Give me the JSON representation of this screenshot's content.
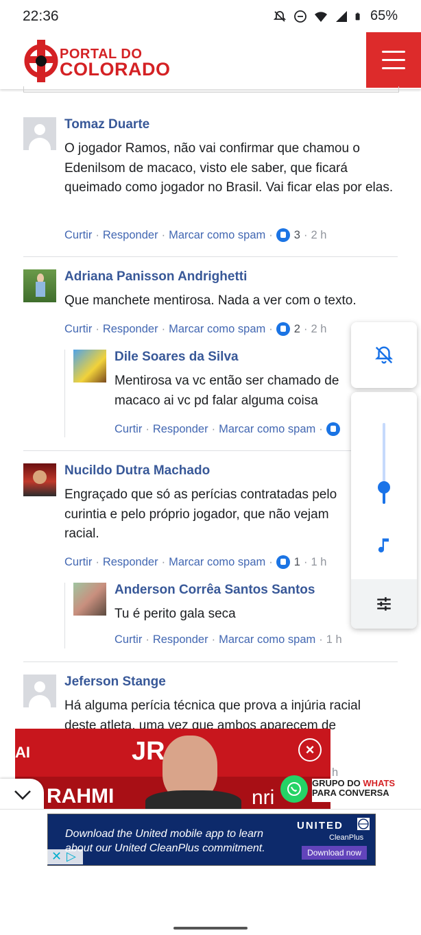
{
  "status_bar": {
    "time": "22:36",
    "battery": "65%"
  },
  "header": {
    "logo_line1": "PORTAL DO",
    "logo_line2": "COLORADO",
    "menu_icon": "hamburger-icon"
  },
  "actions_labels": {
    "like": "Curtir",
    "reply": "Responder",
    "spam": "Marcar como spam"
  },
  "comments": [
    {
      "name": "Tomaz Duarte",
      "text": "O jogador Ramos, não vai confirmar que chamou o Edenilsom de macaco, visto ele saber, que ficará queimado como jogador no Brasil. Vai ficar elas por elas.",
      "likes": "3",
      "time": "2 h"
    },
    {
      "name": "Adriana Panisson Andrighetti",
      "text": "Que manchete mentirosa. Nada a ver com o texto.",
      "likes": "2",
      "time": "2 h",
      "reply": {
        "name": "Dile Soares da Silva",
        "text": "Mentirosa va vc então ser chamado de macaco ai vc pd falar alguma coisa"
      }
    },
    {
      "name": "Nucildo Dutra Machado",
      "text": "Engraçado que só as perícias contratadas pelo curintia e pelo próprio jogador, que não vejam racial.",
      "likes": "1",
      "time": "1 h",
      "reply": {
        "name": "Anderson Corrêa Santos Santos",
        "text": "Tu é perito gala seca",
        "time": "1 h"
      }
    },
    {
      "name": "Jeferson Stange",
      "text": "Há alguma perícia técnica que prova a injúria racial deste atleta, uma vez que ambos aparecem de",
      "time": "h"
    }
  ],
  "volume_panel": {
    "level": 0.2,
    "mute_icon": "bell-off-icon",
    "music_icon": "music-note-icon",
    "settings_icon": "equalizer-icon"
  },
  "ad_video": {
    "banner_text": "GRUPO DO WHATS PARA CONVERSA",
    "banner_prefix": "GRUPO DO ",
    "banner_accent": "WHATS",
    "banner_suffix": "PARA CONVERSA",
    "left_text": "AI",
    "brand_text": "JR",
    "bottom_text": "RAHMI",
    "right_text": "nri"
  },
  "ad_bottom": {
    "text": "Download the United mobile app to learn about our United CleanPlus commitment.",
    "brand": "UNITED",
    "sub_brand": "CleanPlus",
    "cta": "Download now"
  },
  "colors": {
    "accent_red": "#dd2b2b",
    "link_blue": "#385898",
    "action_blue": "#4267b2",
    "volume_blue": "#1a73e8"
  }
}
